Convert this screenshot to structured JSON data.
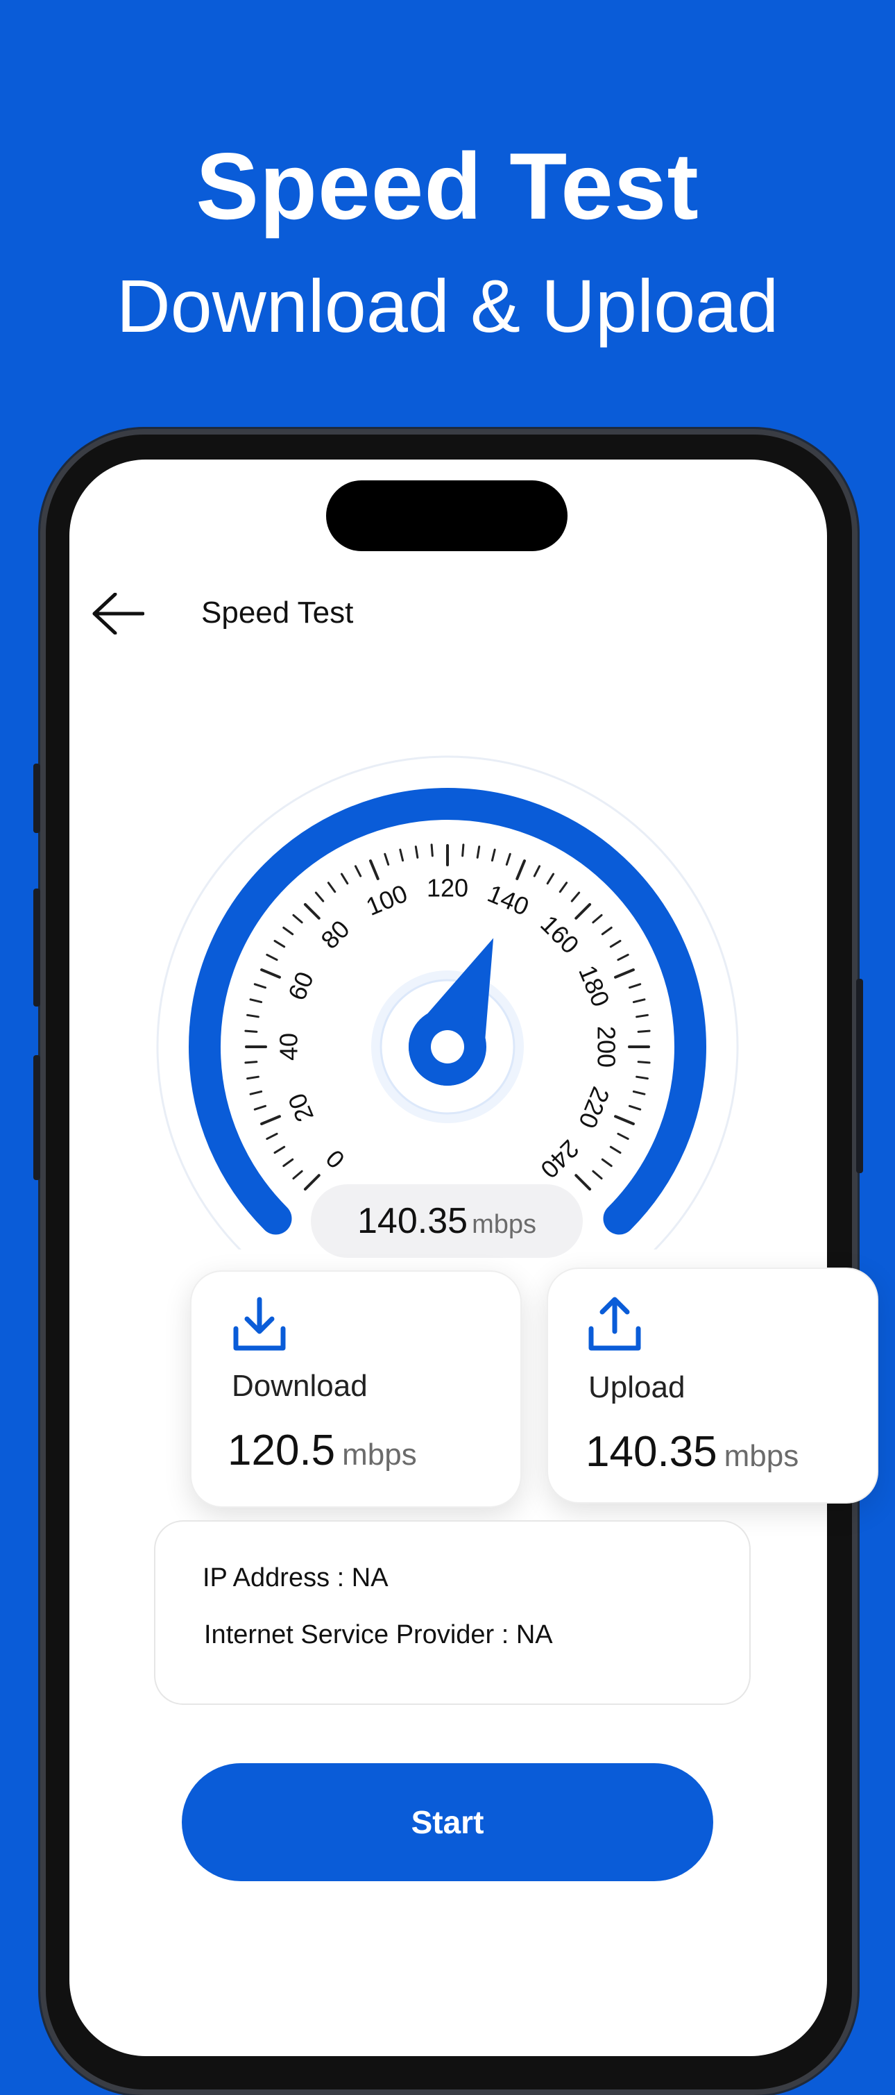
{
  "hero": {
    "title": "Speed Test",
    "subtitle": "Download & Upload"
  },
  "header": {
    "title": "Speed Test"
  },
  "gauge": {
    "ticks": [
      "0",
      "20",
      "40",
      "60",
      "80",
      "100",
      "120",
      "140",
      "160",
      "180",
      "200",
      "220",
      "240"
    ],
    "min": 0,
    "max": 240,
    "needle_value": 140.35
  },
  "readout": {
    "value": "140.35",
    "unit": "mbps"
  },
  "cards": {
    "download": {
      "label": "Download",
      "value": "120.5",
      "unit": "mbps"
    },
    "upload": {
      "label": "Upload",
      "value": "140.35",
      "unit": "mbps"
    }
  },
  "info": {
    "ip": "IP Address : NA",
    "isp": "Internet Service Provider : NA"
  },
  "start_label": "Start",
  "colors": {
    "accent": "#0A5CD8",
    "background": "#0A5CD8",
    "screen": "#FFFFFF"
  }
}
